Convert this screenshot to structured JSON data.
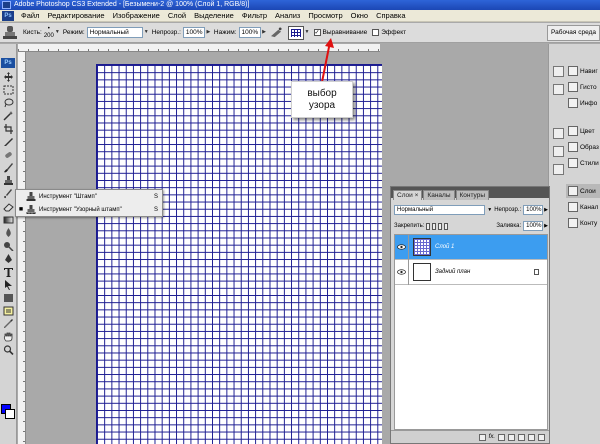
{
  "window": {
    "title": "Adobe Photoshop CS3 Extended - [Безымени-2 @ 100% (Слой 1, RGB/8)]",
    "ps_badge": "Ps"
  },
  "menu": {
    "items": [
      "Файл",
      "Редактирование",
      "Изображение",
      "Слой",
      "Выделение",
      "Фильтр",
      "Анализ",
      "Просмотр",
      "Окно",
      "Справка"
    ]
  },
  "options": {
    "brush_label": "Кисть:",
    "brush_size": "200",
    "mode_label": "Режим:",
    "mode_value": "Нормальный",
    "opacity_label": "Непрозр.:",
    "opacity_value": "100%",
    "pressure_label": "Нажим:",
    "pressure_value": "100%",
    "aligned_label": "Выравнивание",
    "aligned_checked": "✓",
    "effect_label": "Эффект",
    "workspace_label": "Рабочая среда"
  },
  "annotation": {
    "line1": "выбор",
    "line2": "узора"
  },
  "flyout": {
    "items": [
      {
        "label": "Инструмент \"Штамп\"",
        "key": "S",
        "selected": ""
      },
      {
        "label": "Инструмент \"Узорный штамп\"",
        "key": "S",
        "selected": "■"
      }
    ]
  },
  "dock": {
    "items": [
      "Навиг",
      "Гисто",
      "Инфо",
      "Цвет",
      "Образ",
      "Стили",
      "Слои",
      "Канал",
      "Конту"
    ]
  },
  "layers_panel": {
    "tabs": [
      "Слои ×",
      "Каналы",
      "Контуры"
    ],
    "blend_mode": "Нормальный",
    "opacity_label": "Непрозр.:",
    "opacity_value": "100%",
    "lock_label": "Закрепить:",
    "fill_label": "Заливка:",
    "fill_value": "100%",
    "layers": [
      {
        "name": "Слой 1",
        "selected": true
      },
      {
        "name": "Задний план",
        "selected": false
      }
    ],
    "footer_icons": [
      "link-icon",
      "fx-icon",
      "mask-icon",
      "adjustment-icon",
      "folder-icon",
      "new-layer-icon",
      "trash-icon"
    ],
    "fx_label": "fx."
  },
  "colors": {
    "foreground": "#0000ff",
    "background": "#ffffff",
    "grid_line": "#1a1a90",
    "selection": "#3c9df0",
    "arrow": "#e01010"
  }
}
